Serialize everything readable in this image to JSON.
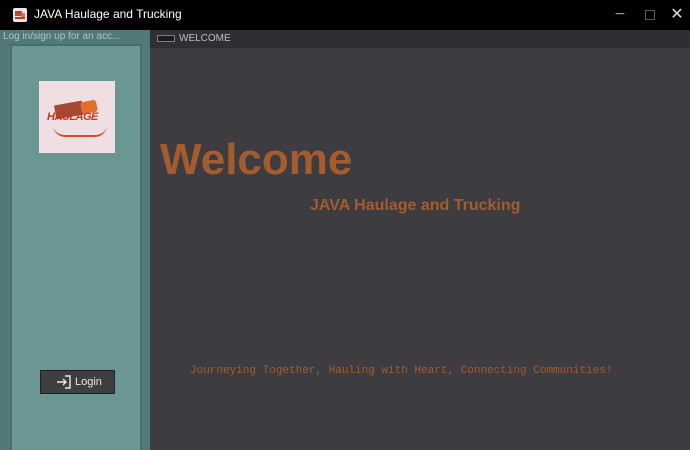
{
  "window": {
    "title": "JAVA Haulage and Trucking",
    "minimize_label": "−",
    "close_label": "✕"
  },
  "left_panel": {
    "title": "Log in/sign up for an acc...",
    "logo": {
      "text": "HAULAGE"
    },
    "login_button": {
      "label": "Login",
      "icon": "login-icon"
    }
  },
  "tabs": [
    {
      "label": "WELCOME",
      "icon": "tab-icon"
    }
  ],
  "main": {
    "heading": "Welcome",
    "subtitle": "JAVA Haulage and Trucking",
    "tagline": "Journeying Together, Hauling with Heart, Connecting Communities!"
  },
  "colors": {
    "accent": "#a45c2e",
    "panel": "#6a9694",
    "background": "#3c3c41"
  }
}
